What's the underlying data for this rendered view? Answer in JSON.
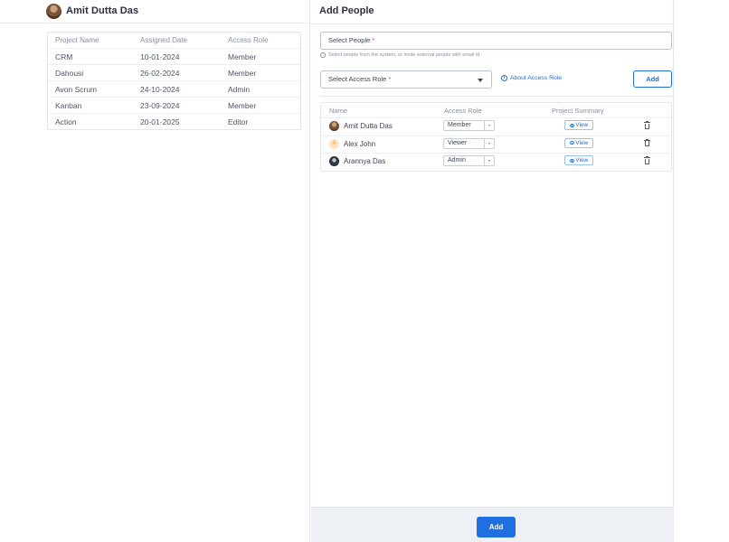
{
  "user": {
    "name": "Amit Dutta Das"
  },
  "projects": {
    "headers": [
      "Project Name",
      "Assigned Date",
      "Access Role"
    ],
    "rows": [
      {
        "name": "CRM",
        "date": "10-01-2024",
        "role": "Member"
      },
      {
        "name": "Dahousi",
        "date": "26-02-2024",
        "role": "Member"
      },
      {
        "name": "Avon Scrum",
        "date": "24-10-2024",
        "role": "Admin"
      },
      {
        "name": "Kanban",
        "date": "23-09-2024",
        "role": "Member"
      },
      {
        "name": "Action",
        "date": "20-01-2025",
        "role": "Editor"
      }
    ]
  },
  "add_people": {
    "title": "Add People",
    "select_people_placeholder": "Select People",
    "required_mark": "*",
    "hint": "Select people from the system, or invite external people with email id.",
    "access_role_placeholder": "Select Access Role",
    "about_access_role": "About Access Role",
    "add_label": "Add",
    "table": {
      "headers": [
        "Name",
        "Access Role",
        "Project Summary"
      ],
      "view_label": "View",
      "rows": [
        {
          "name": "Amit Dutta Das",
          "role": "Member",
          "avatar": "photo"
        },
        {
          "name": "Alex John",
          "role": "Viewer",
          "avatar": "A"
        },
        {
          "name": "Arannya Das",
          "role": "Admin",
          "avatar": "photo"
        }
      ]
    },
    "footer_add_label": "Add"
  },
  "colors": {
    "accent": "#1f6fd1",
    "primary_button": "#1f6fe0",
    "required": "#e0434a"
  }
}
